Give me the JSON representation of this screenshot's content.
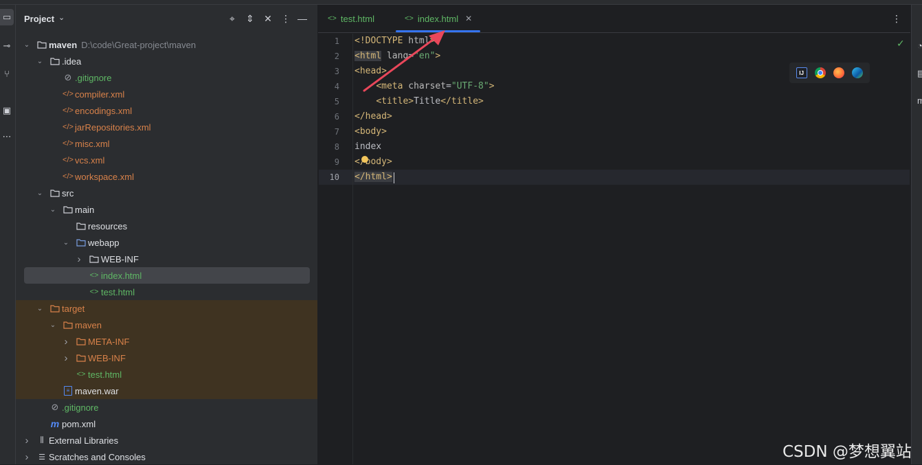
{
  "project_panel": {
    "title": "Project",
    "tree": [
      {
        "name": "maven",
        "hint": "D:\\code\\Great-project\\maven",
        "depth": 0,
        "expanded": true,
        "type": "module"
      },
      {
        "name": ".idea",
        "depth": 1,
        "expanded": true,
        "type": "folder"
      },
      {
        "name": ".gitignore",
        "depth": 2,
        "type": "gitignore"
      },
      {
        "name": "compiler.xml",
        "depth": 2,
        "type": "xml"
      },
      {
        "name": "encodings.xml",
        "depth": 2,
        "type": "xml"
      },
      {
        "name": "jarRepositories.xml",
        "depth": 2,
        "type": "xml"
      },
      {
        "name": "misc.xml",
        "depth": 2,
        "type": "xml"
      },
      {
        "name": "vcs.xml",
        "depth": 2,
        "type": "xml"
      },
      {
        "name": "workspace.xml",
        "depth": 2,
        "type": "xml"
      },
      {
        "name": "src",
        "depth": 1,
        "expanded": true,
        "type": "folder"
      },
      {
        "name": "main",
        "depth": 2,
        "expanded": true,
        "type": "folder"
      },
      {
        "name": "resources",
        "depth": 3,
        "type": "resources"
      },
      {
        "name": "webapp",
        "depth": 3,
        "expanded": true,
        "type": "webfolder"
      },
      {
        "name": "WEB-INF",
        "depth": 4,
        "expanded": false,
        "type": "folder"
      },
      {
        "name": "index.html",
        "depth": 4,
        "type": "html",
        "selected": true
      },
      {
        "name": "test.html",
        "depth": 4,
        "type": "html"
      },
      {
        "name": "target",
        "depth": 1,
        "expanded": true,
        "type": "excluded"
      },
      {
        "name": "maven",
        "depth": 2,
        "expanded": true,
        "type": "excluded"
      },
      {
        "name": "META-INF",
        "depth": 3,
        "expanded": false,
        "type": "excluded"
      },
      {
        "name": "WEB-INF",
        "depth": 3,
        "expanded": false,
        "type": "excluded"
      },
      {
        "name": "test.html",
        "depth": 3,
        "type": "excluded-html"
      },
      {
        "name": "maven.war",
        "depth": 2,
        "type": "war"
      },
      {
        "name": ".gitignore",
        "depth": 1,
        "type": "gitignore"
      },
      {
        "name": "pom.xml",
        "depth": 1,
        "type": "pom"
      },
      {
        "name": "External Libraries",
        "depth": 0,
        "expanded": false,
        "type": "libraries"
      },
      {
        "name": "Scratches and Consoles",
        "depth": 0,
        "expanded": false,
        "type": "scratches"
      }
    ]
  },
  "editor": {
    "tabs": [
      {
        "label": "test.html",
        "active": false
      },
      {
        "label": "index.html",
        "active": true
      }
    ],
    "line_numbers": [
      "1",
      "2",
      "3",
      "4",
      "5",
      "6",
      "7",
      "8",
      "9",
      "10"
    ],
    "lines": [
      [
        {
          "t": "tag",
          "s": "<!DOCTYPE "
        },
        {
          "t": "attr",
          "s": "html"
        },
        {
          "t": "tag",
          "s": ">"
        }
      ],
      [
        {
          "t": "tag hl",
          "s": "<html"
        },
        {
          "t": "txt",
          "s": " "
        },
        {
          "t": "attr",
          "s": "lang"
        },
        {
          "t": "txt",
          "s": "="
        },
        {
          "t": "str",
          "s": "\"en\""
        },
        {
          "t": "tag",
          "s": ">"
        }
      ],
      [
        {
          "t": "tag",
          "s": "<head>"
        }
      ],
      [
        {
          "t": "txt",
          "s": "    "
        },
        {
          "t": "tag",
          "s": "<meta "
        },
        {
          "t": "attr",
          "s": "charset"
        },
        {
          "t": "txt",
          "s": "="
        },
        {
          "t": "str",
          "s": "\"UTF-8\""
        },
        {
          "t": "tag",
          "s": ">"
        }
      ],
      [
        {
          "t": "txt",
          "s": "    "
        },
        {
          "t": "tag",
          "s": "<title>"
        },
        {
          "t": "txt",
          "s": "Title"
        },
        {
          "t": "tag",
          "s": "</title>"
        }
      ],
      [
        {
          "t": "tag",
          "s": "</head>"
        }
      ],
      [
        {
          "t": "tag",
          "s": "<body>"
        }
      ],
      [
        {
          "t": "txt",
          "s": "index"
        }
      ],
      [
        {
          "t": "tag",
          "s": "</body>"
        }
      ],
      [
        {
          "t": "tag hl",
          "s": "</html>"
        }
      ]
    ],
    "current_line": 10,
    "browser_icons": [
      "intellij-icon",
      "chrome-icon",
      "firefox-icon",
      "edge-icon"
    ],
    "browser_icon_text": {
      "intellij": "IJ"
    }
  },
  "watermark": "CSDN @梦想翼站",
  "colors": {
    "accent_blue": "#3574f0",
    "arrow_red": "#e9475a",
    "excluded_bg": "#3f3321"
  }
}
